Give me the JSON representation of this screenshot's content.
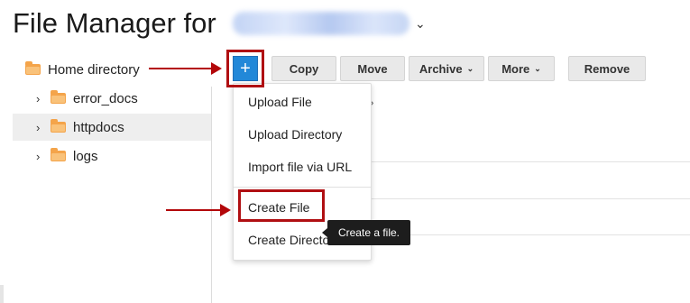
{
  "header": {
    "title": "File Manager for"
  },
  "tree": [
    {
      "label": "Home directory",
      "expandable": false,
      "selected": false
    },
    {
      "label": "error_docs",
      "expandable": true,
      "selected": false
    },
    {
      "label": "httpdocs",
      "expandable": true,
      "selected": true
    },
    {
      "label": "logs",
      "expandable": true,
      "selected": false
    }
  ],
  "toolbar": {
    "add_label": "+",
    "copy_label": "Copy",
    "move_label": "Move",
    "archive_label": "Archive",
    "more_label": "More",
    "remove_label": "Remove"
  },
  "menu": {
    "items": [
      "Upload File",
      "Upload Directory",
      "Import file via URL",
      "Create File",
      "Create Directo"
    ]
  },
  "tooltip": "Create a file.",
  "background": {
    "crumb": "s  ›"
  },
  "colors": {
    "accent": "#2288d8",
    "annotation": "#b00f12",
    "folder": "#f4a44a"
  }
}
